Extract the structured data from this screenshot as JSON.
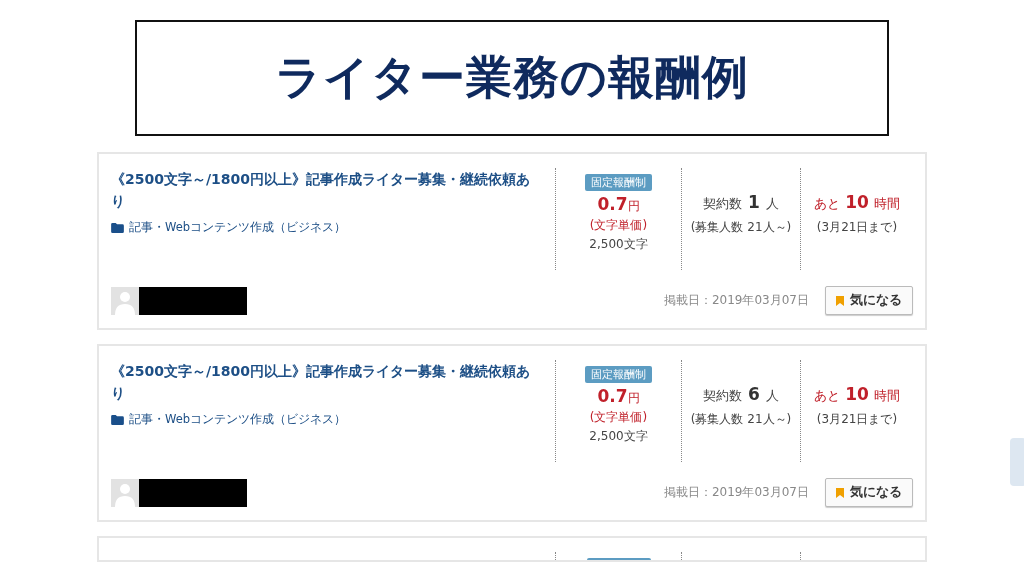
{
  "slide_title": "ライター業務の報酬例",
  "listings": [
    {
      "title": "《2500文字～/1800円以上》記事作成ライター募集・継続依頼あり",
      "category": "記事・Webコンテンツ作成（ビジネス）",
      "pay_type": "固定報酬制",
      "price": "0.7",
      "price_unit": "円",
      "price_note": "(文字単価)",
      "word_count": "2,500文字",
      "contracts_label": "契約数",
      "contracts_count": "1",
      "contracts_unit": "人",
      "recruit_note": "(募集人数 21人～)",
      "remaining_prefix": "あと",
      "remaining_value": "10",
      "remaining_unit": "時間",
      "deadline": "(3月21日まで)",
      "posted": "掲載日：2019年03月07日",
      "bookmark_label": "気になる"
    },
    {
      "title": "《2500文字～/1800円以上》記事作成ライター募集・継続依頼あり",
      "category": "記事・Webコンテンツ作成（ビジネス）",
      "pay_type": "固定報酬制",
      "price": "0.7",
      "price_unit": "円",
      "price_note": "(文字単価)",
      "word_count": "2,500文字",
      "contracts_label": "契約数",
      "contracts_count": "6",
      "contracts_unit": "人",
      "recruit_note": "(募集人数 21人～)",
      "remaining_prefix": "あと",
      "remaining_value": "10",
      "remaining_unit": "時間",
      "deadline": "(3月21日まで)",
      "posted": "掲載日：2019年03月07日",
      "bookmark_label": "気になる"
    }
  ]
}
